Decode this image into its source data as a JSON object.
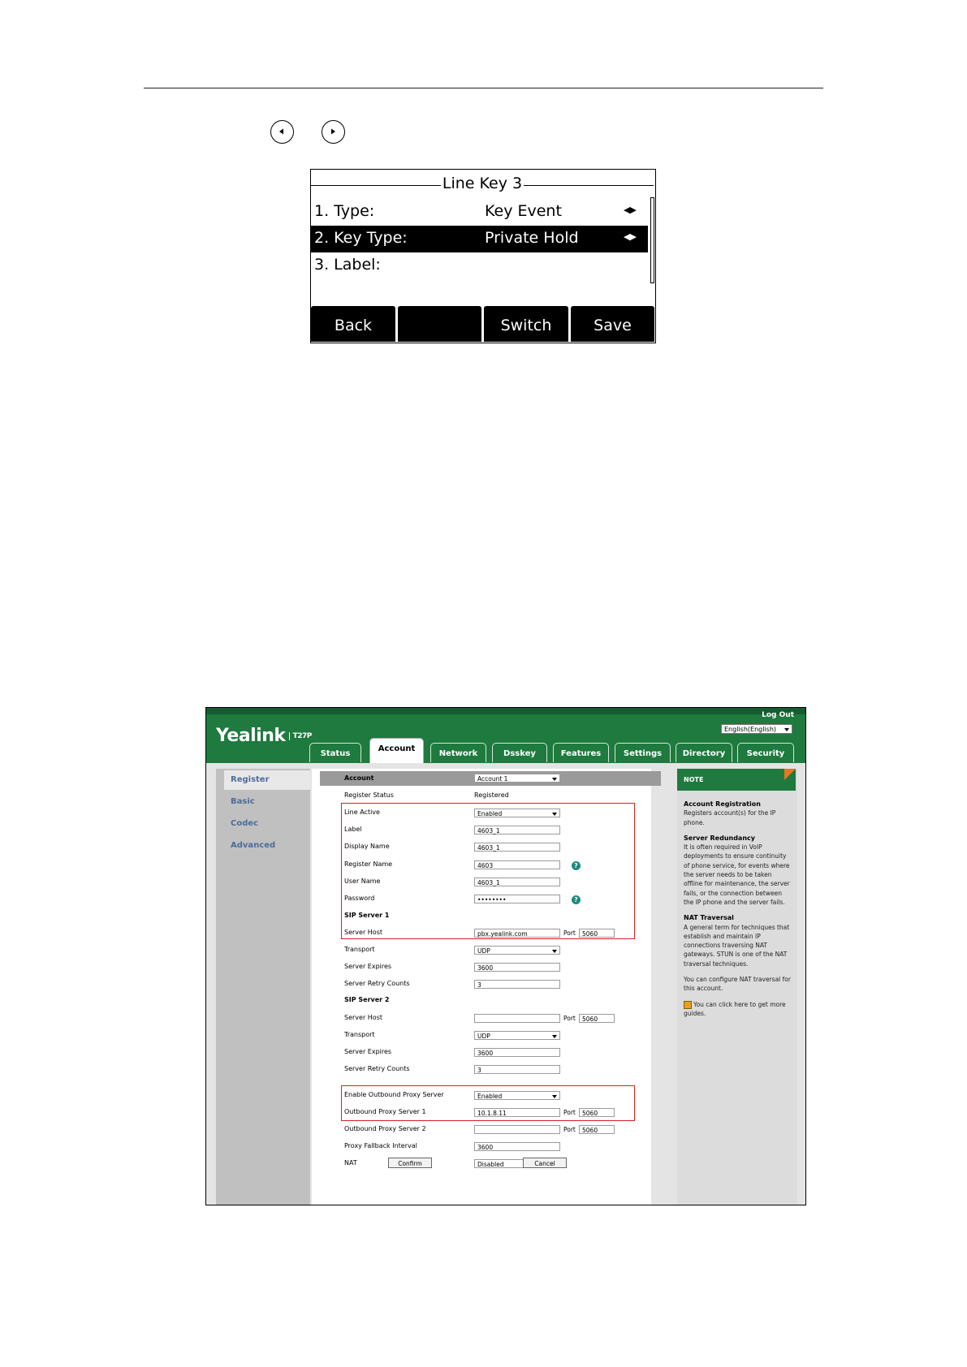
{
  "lcd": {
    "title": "Line Key 3",
    "rows": [
      {
        "key": "1. Type:",
        "value": "Key Event",
        "arrows": "◀▶"
      },
      {
        "key": "2. Key Type:",
        "value": "Private Hold",
        "arrows": "◀▶"
      },
      {
        "key": "3. Label:",
        "value": "",
        "arrows": ""
      }
    ],
    "softkeys": [
      "Back",
      "",
      "Switch",
      "Save"
    ]
  },
  "web": {
    "logo": "Yealink",
    "model": "T27P",
    "logout": "Log Out",
    "language": "English(English)",
    "tabs": [
      "Status",
      "Account",
      "Network",
      "Dsskey",
      "Features",
      "Settings",
      "Directory",
      "Security"
    ],
    "active_tab": "Account",
    "leftnav": [
      "Register",
      "Basic",
      "Codec",
      "Advanced"
    ],
    "form": {
      "account_label": "Account",
      "account_value": "Account 1",
      "register_status_label": "Register Status",
      "register_status_value": "Registered",
      "line_active_label": "Line Active",
      "line_active_value": "Enabled",
      "label_label": "Label",
      "label_value": "4603_1",
      "display_name_label": "Display Name",
      "display_name_value": "4603_1",
      "register_name_label": "Register Name",
      "register_name_value": "4603",
      "user_name_label": "User Name",
      "user_name_value": "4603_1",
      "password_label": "Password",
      "password_value": "••••••••",
      "sip1_label": "SIP Server 1",
      "server_host_label": "Server Host",
      "sip1_host_value": "pbx.yealink.com",
      "port_label": "Port",
      "sip1_port": "5060",
      "transport_label": "Transport",
      "sip1_transport": "UDP",
      "server_expires_label": "Server Expires",
      "sip1_expires": "3600",
      "server_retry_label": "Server Retry Counts",
      "sip1_retry": "3",
      "sip2_label": "SIP Server 2",
      "sip2_host_value": "",
      "sip2_port": "5060",
      "sip2_transport": "UDP",
      "sip2_expires": "3600",
      "sip2_retry": "3",
      "outbound_enable_label": "Enable Outbound Proxy Server",
      "outbound_enable_value": "Enabled",
      "outbound1_label": "Outbound Proxy Server 1",
      "outbound1_value": "10.1.8.11",
      "outbound1_port": "5060",
      "outbound2_label": "Outbound Proxy Server 2",
      "outbound2_value": "",
      "outbound2_port": "5060",
      "fallback_label": "Proxy Fallback Interval",
      "fallback_value": "3600",
      "nat_label": "NAT",
      "nat_value": "Disabled",
      "confirm": "Confirm",
      "cancel": "Cancel"
    },
    "note": {
      "title": "NOTE",
      "h1": "Account Registration",
      "t1": "Registers account(s) for the IP phone.",
      "h2": "Server Redundancy",
      "t2": "It is often required in VoIP deployments to ensure continuity of phone service, for events where the server needs to be taken offline for maintenance, the server fails, or the connection between the IP phone and the server fails.",
      "h3": "NAT Traversal",
      "t3": "A general term for techniques that establish and maintain IP connections traversing NAT gateways. STUN is one of the NAT traversal techniques.",
      "t4": "You can configure NAT traversal for this account.",
      "t5": "You can click here to get more guides."
    }
  }
}
